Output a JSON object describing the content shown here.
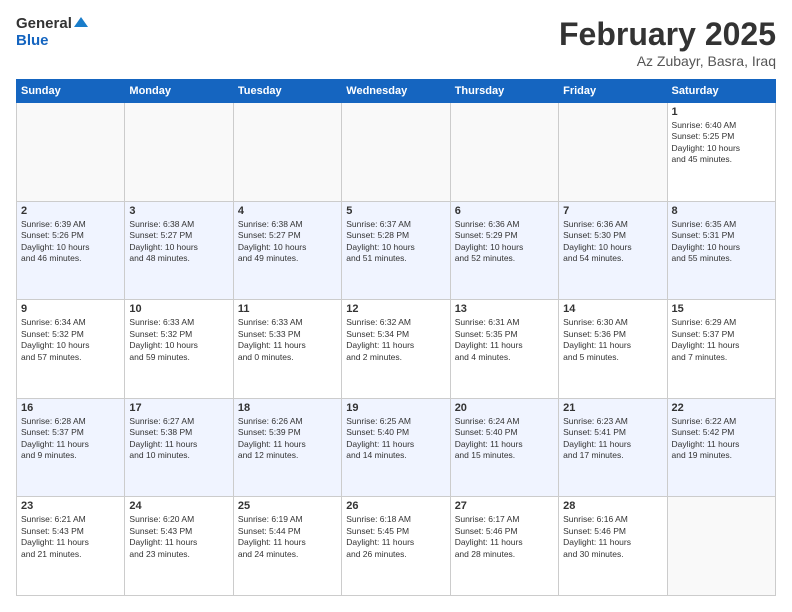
{
  "header": {
    "logo_line1": "General",
    "logo_line2": "Blue",
    "month": "February 2025",
    "location": "Az Zubayr, Basra, Iraq"
  },
  "days_of_week": [
    "Sunday",
    "Monday",
    "Tuesday",
    "Wednesday",
    "Thursday",
    "Friday",
    "Saturday"
  ],
  "weeks": [
    {
      "alt": false,
      "days": [
        {
          "num": "",
          "info": ""
        },
        {
          "num": "",
          "info": ""
        },
        {
          "num": "",
          "info": ""
        },
        {
          "num": "",
          "info": ""
        },
        {
          "num": "",
          "info": ""
        },
        {
          "num": "",
          "info": ""
        },
        {
          "num": "1",
          "info": "Sunrise: 6:40 AM\nSunset: 5:25 PM\nDaylight: 10 hours\nand 45 minutes."
        }
      ]
    },
    {
      "alt": true,
      "days": [
        {
          "num": "2",
          "info": "Sunrise: 6:39 AM\nSunset: 5:26 PM\nDaylight: 10 hours\nand 46 minutes."
        },
        {
          "num": "3",
          "info": "Sunrise: 6:38 AM\nSunset: 5:27 PM\nDaylight: 10 hours\nand 48 minutes."
        },
        {
          "num": "4",
          "info": "Sunrise: 6:38 AM\nSunset: 5:27 PM\nDaylight: 10 hours\nand 49 minutes."
        },
        {
          "num": "5",
          "info": "Sunrise: 6:37 AM\nSunset: 5:28 PM\nDaylight: 10 hours\nand 51 minutes."
        },
        {
          "num": "6",
          "info": "Sunrise: 6:36 AM\nSunset: 5:29 PM\nDaylight: 10 hours\nand 52 minutes."
        },
        {
          "num": "7",
          "info": "Sunrise: 6:36 AM\nSunset: 5:30 PM\nDaylight: 10 hours\nand 54 minutes."
        },
        {
          "num": "8",
          "info": "Sunrise: 6:35 AM\nSunset: 5:31 PM\nDaylight: 10 hours\nand 55 minutes."
        }
      ]
    },
    {
      "alt": false,
      "days": [
        {
          "num": "9",
          "info": "Sunrise: 6:34 AM\nSunset: 5:32 PM\nDaylight: 10 hours\nand 57 minutes."
        },
        {
          "num": "10",
          "info": "Sunrise: 6:33 AM\nSunset: 5:32 PM\nDaylight: 10 hours\nand 59 minutes."
        },
        {
          "num": "11",
          "info": "Sunrise: 6:33 AM\nSunset: 5:33 PM\nDaylight: 11 hours\nand 0 minutes."
        },
        {
          "num": "12",
          "info": "Sunrise: 6:32 AM\nSunset: 5:34 PM\nDaylight: 11 hours\nand 2 minutes."
        },
        {
          "num": "13",
          "info": "Sunrise: 6:31 AM\nSunset: 5:35 PM\nDaylight: 11 hours\nand 4 minutes."
        },
        {
          "num": "14",
          "info": "Sunrise: 6:30 AM\nSunset: 5:36 PM\nDaylight: 11 hours\nand 5 minutes."
        },
        {
          "num": "15",
          "info": "Sunrise: 6:29 AM\nSunset: 5:37 PM\nDaylight: 11 hours\nand 7 minutes."
        }
      ]
    },
    {
      "alt": true,
      "days": [
        {
          "num": "16",
          "info": "Sunrise: 6:28 AM\nSunset: 5:37 PM\nDaylight: 11 hours\nand 9 minutes."
        },
        {
          "num": "17",
          "info": "Sunrise: 6:27 AM\nSunset: 5:38 PM\nDaylight: 11 hours\nand 10 minutes."
        },
        {
          "num": "18",
          "info": "Sunrise: 6:26 AM\nSunset: 5:39 PM\nDaylight: 11 hours\nand 12 minutes."
        },
        {
          "num": "19",
          "info": "Sunrise: 6:25 AM\nSunset: 5:40 PM\nDaylight: 11 hours\nand 14 minutes."
        },
        {
          "num": "20",
          "info": "Sunrise: 6:24 AM\nSunset: 5:40 PM\nDaylight: 11 hours\nand 15 minutes."
        },
        {
          "num": "21",
          "info": "Sunrise: 6:23 AM\nSunset: 5:41 PM\nDaylight: 11 hours\nand 17 minutes."
        },
        {
          "num": "22",
          "info": "Sunrise: 6:22 AM\nSunset: 5:42 PM\nDaylight: 11 hours\nand 19 minutes."
        }
      ]
    },
    {
      "alt": false,
      "days": [
        {
          "num": "23",
          "info": "Sunrise: 6:21 AM\nSunset: 5:43 PM\nDaylight: 11 hours\nand 21 minutes."
        },
        {
          "num": "24",
          "info": "Sunrise: 6:20 AM\nSunset: 5:43 PM\nDaylight: 11 hours\nand 23 minutes."
        },
        {
          "num": "25",
          "info": "Sunrise: 6:19 AM\nSunset: 5:44 PM\nDaylight: 11 hours\nand 24 minutes."
        },
        {
          "num": "26",
          "info": "Sunrise: 6:18 AM\nSunset: 5:45 PM\nDaylight: 11 hours\nand 26 minutes."
        },
        {
          "num": "27",
          "info": "Sunrise: 6:17 AM\nSunset: 5:46 PM\nDaylight: 11 hours\nand 28 minutes."
        },
        {
          "num": "28",
          "info": "Sunrise: 6:16 AM\nSunset: 5:46 PM\nDaylight: 11 hours\nand 30 minutes."
        },
        {
          "num": "",
          "info": ""
        }
      ]
    }
  ]
}
